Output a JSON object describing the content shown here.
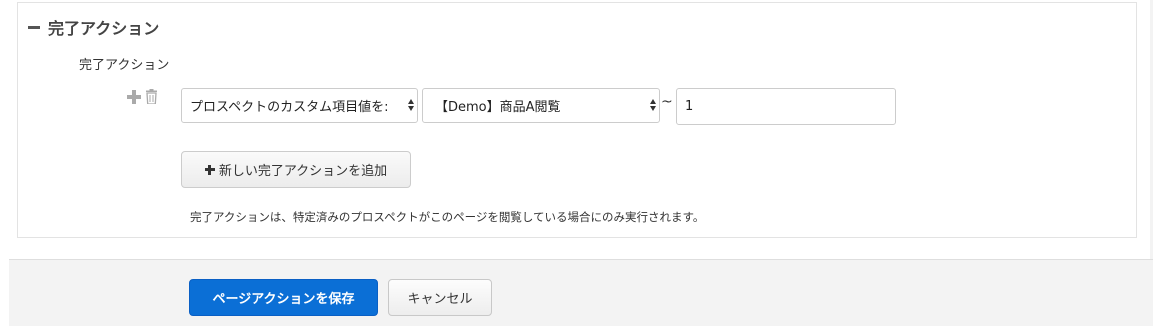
{
  "section": {
    "title": "完了アクション",
    "field_label": "完了アクション"
  },
  "row": {
    "select1_value": "プロスペクトのカスタム項目値を:",
    "select2_value": "【Demo】商品A閲覧",
    "tilde": "~",
    "number_value": "1"
  },
  "add_button_label": "新しい完了アクションを追加",
  "help_text": "完了アクションは、特定済みのプロスペクトがこのページを閲覧している場合にのみ実行されます。",
  "footer": {
    "save_label": "ページアクションを保存",
    "cancel_label": "キャンセル"
  },
  "colors": {
    "primary": "#0b6fd6",
    "footer_bg": "#f3f3f3"
  },
  "icons": [
    "minus-icon",
    "plus-icon",
    "trash-icon",
    "select-arrows-icon"
  ]
}
